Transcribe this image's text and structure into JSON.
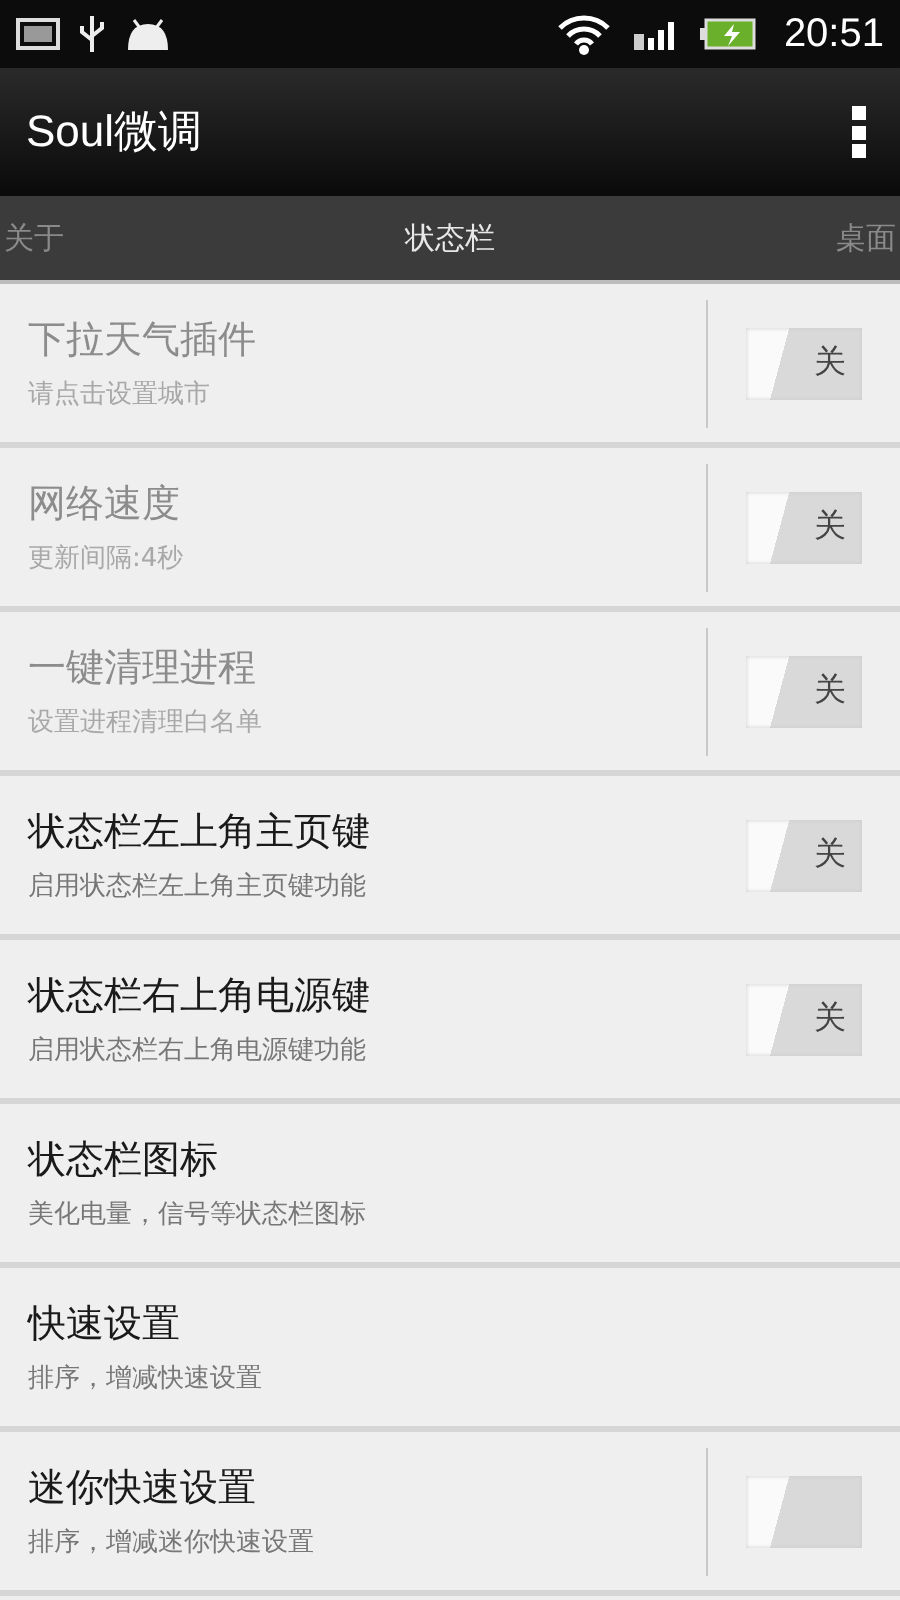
{
  "status_bar": {
    "time": "20:51"
  },
  "app_bar": {
    "title": "Soul微调"
  },
  "tabs": [
    {
      "label": "关于",
      "selected": false
    },
    {
      "label": "状态栏",
      "selected": true
    },
    {
      "label": "桌面",
      "selected": false
    }
  ],
  "settings": [
    {
      "kind": "toggle",
      "title": "下拉天气插件",
      "summary": "请点击设置城市",
      "disabled": true,
      "divider": true,
      "on": false,
      "switch_label": "关"
    },
    {
      "kind": "toggle",
      "title": "网络速度",
      "summary": "更新间隔:4秒",
      "disabled": true,
      "divider": true,
      "on": false,
      "switch_label": "关"
    },
    {
      "kind": "toggle",
      "title": "一键清理进程",
      "summary": "设置进程清理白名单",
      "disabled": true,
      "divider": true,
      "on": false,
      "switch_label": "关"
    },
    {
      "kind": "toggle",
      "title": "状态栏左上角主页键",
      "summary": "启用状态栏左上角主页键功能",
      "disabled": false,
      "divider": false,
      "on": false,
      "switch_label": "关"
    },
    {
      "kind": "toggle",
      "title": "状态栏右上角电源键",
      "summary": "启用状态栏右上角电源键功能",
      "disabled": false,
      "divider": false,
      "on": false,
      "switch_label": "关"
    },
    {
      "kind": "plain",
      "title": "状态栏图标",
      "summary": "美化电量，信号等状态栏图标",
      "disabled": false
    },
    {
      "kind": "plain",
      "title": "快速设置",
      "summary": "排序，增减快速设置",
      "disabled": false
    },
    {
      "kind": "toggle",
      "title": "迷你快速设置",
      "summary": "排序，增减迷你快速设置",
      "disabled": false,
      "divider": true,
      "on": false
    }
  ]
}
